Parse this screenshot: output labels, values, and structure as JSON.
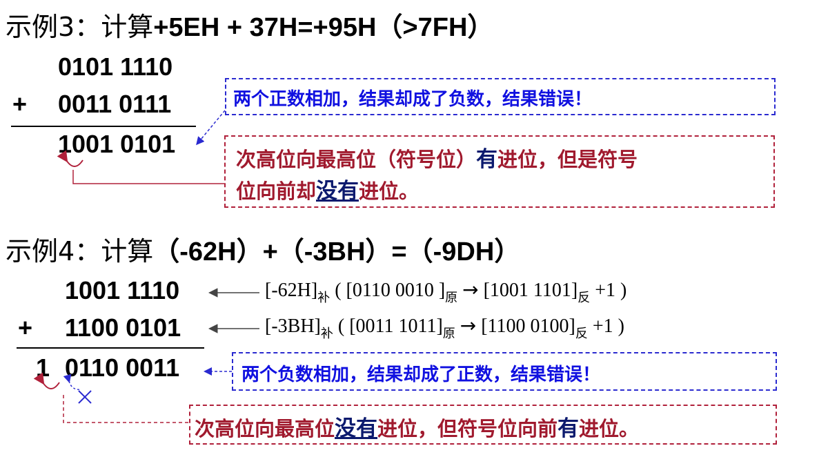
{
  "ex3": {
    "title_prefix": "示例3：",
    "title_calc": "计算",
    "title_expr": "+5EH + 37H=+95H（>7FH）",
    "row1": "0101 1110",
    "plus": "+",
    "row2": "0011 0111",
    "result": "1001 0101",
    "note_blue": "两个正数相加，结果却成了负数，结果错误！",
    "note_red_1a": "次高位向最高位（符号位）",
    "note_red_1b": "有",
    "note_red_1c": "进位，但是符号",
    "note_red_2a": "位向前却",
    "note_red_2b": "没有",
    "note_red_2c": "进位。"
  },
  "ex4": {
    "title_prefix": "示例4：",
    "title_calc": "计算",
    "title_expr": "（-62H）+（-3BH）=（-9DH）",
    "row1": "1001 1110",
    "plus": "+",
    "row2": "1100 0101",
    "result_carry": "1",
    "result": "0110 0011",
    "ann1_a": "[-62H]",
    "ann1_a_sub": "补",
    "ann1_b": "( [0110 0010 ]",
    "ann1_b_sub": "原",
    "ann1_arrow": "→",
    "ann1_c": "[1001 1101]",
    "ann1_c_sub": "反",
    "ann1_d": "+1 )",
    "ann2_a": "[-3BH]",
    "ann2_a_sub": "补",
    "ann2_b": "( [0011 1011]",
    "ann2_b_sub": "原",
    "ann2_arrow": "→",
    "ann2_c": "[1100 0100]",
    "ann2_c_sub": "反",
    "ann2_d": "+1 )",
    "note_blue": "两个负数相加，结果却成了正数，结果错误！",
    "note_red_a": "次高位向最高位",
    "note_red_b": "没有",
    "note_red_c": "进位，但符号位向前",
    "note_red_d": "有",
    "note_red_e": "进位。"
  },
  "colors": {
    "blue": "#1010e0",
    "red": "#a01a2e",
    "highlight": "#0c1a6e"
  }
}
